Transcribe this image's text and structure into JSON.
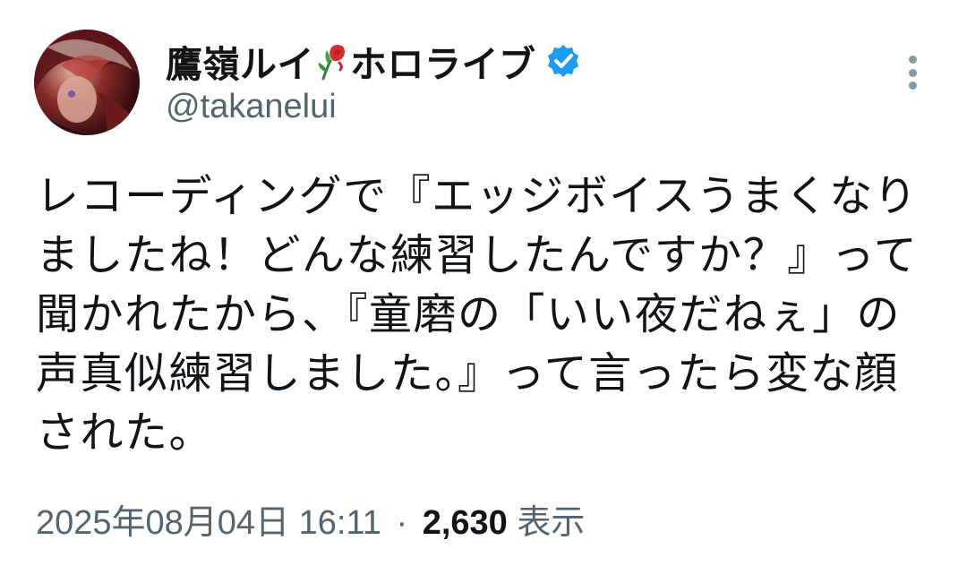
{
  "author": {
    "display_name": "鷹嶺ルイ",
    "display_name_suffix": "ホロライブ",
    "rose_emoji_icon": "wilted-rose-icon",
    "verified_icon": "verified-badge-icon",
    "verified_color": "#1d9bf0",
    "handle": "@takanelui",
    "avatar_icon": "avatar"
  },
  "more_icon": "more-vertical-icon",
  "tweet": {
    "text": "レコーディングで『エッジボイスうまくなりましたね！どんな練習したんですか？』って聞かれたから、『童磨の「いい夜だねぇ」の声真似練習しました。』って言ったら変な顔された。"
  },
  "meta": {
    "timestamp": "2025年08月04日 16:11",
    "separator": "·",
    "view_count": "2,630",
    "view_label": "表示"
  }
}
